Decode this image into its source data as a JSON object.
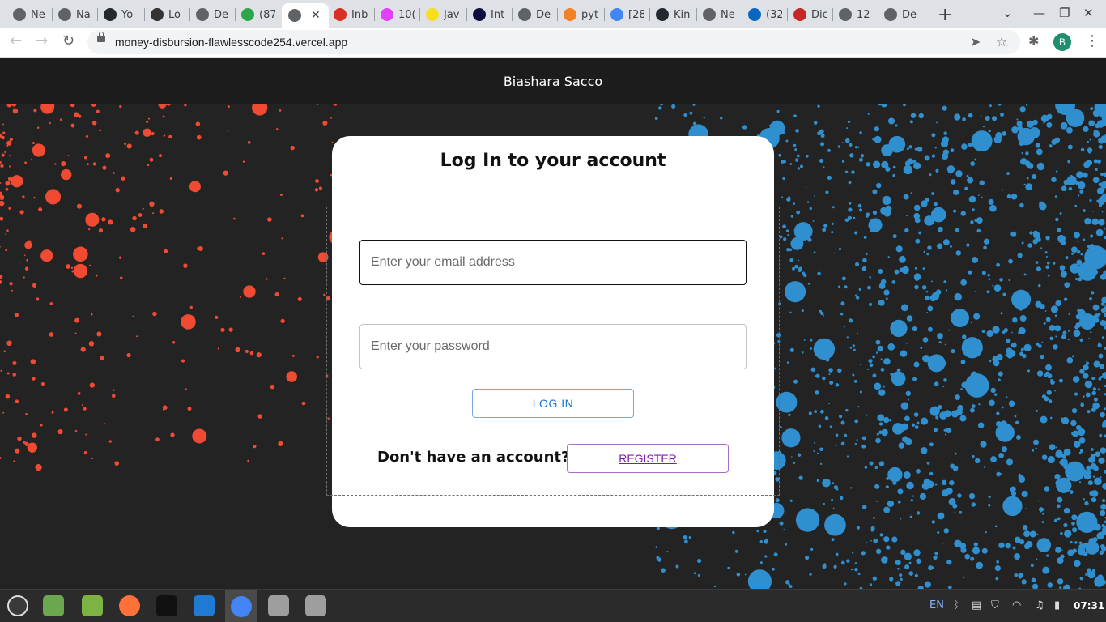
{
  "browser": {
    "tabs": [
      {
        "icon": "chrome-globe-icon",
        "title": "Ne",
        "color": "#5f6368"
      },
      {
        "icon": "globe-icon",
        "title": "Na",
        "color": "#5f6368"
      },
      {
        "icon": "github-icon",
        "title": "Yo",
        "color": "#24292f"
      },
      {
        "icon": "l-icon",
        "title": "Lo",
        "color": "#333333"
      },
      {
        "icon": "globe-icon",
        "title": "De",
        "color": "#5f6368"
      },
      {
        "icon": "badge-87-icon",
        "title": "(87",
        "color": "#2da44e"
      },
      {
        "icon": "globe-icon",
        "title": "",
        "color": "#5f6368",
        "active": true
      },
      {
        "icon": "gmail-icon",
        "title": "Inb",
        "color": "#d93025"
      },
      {
        "icon": "pinwheel-icon",
        "title": "10(",
        "color": "#e040fb"
      },
      {
        "icon": "js-icon",
        "title": "Jav",
        "color": "#f7df1e"
      },
      {
        "icon": "angular-icon",
        "title": "Int",
        "color": "#0f0f3f"
      },
      {
        "icon": "globe-icon",
        "title": "De",
        "color": "#5f6368"
      },
      {
        "icon": "stackoverflow-icon",
        "title": "pyt",
        "color": "#f48024"
      },
      {
        "icon": "google-icon",
        "title": "[28",
        "color": "#4285f4"
      },
      {
        "icon": "github-icon",
        "title": "Kin",
        "color": "#24292f"
      },
      {
        "icon": "chrome-globe-icon",
        "title": "Ne",
        "color": "#5f6368"
      },
      {
        "icon": "linkedin-icon",
        "title": "(32",
        "color": "#0a66c2"
      },
      {
        "icon": "dig-icon",
        "title": "Dic",
        "color": "#c62828"
      },
      {
        "icon": "globe-icon",
        "title": "12",
        "color": "#5f6368"
      },
      {
        "icon": "globe-icon",
        "title": "De",
        "color": "#5f6368"
      }
    ],
    "new_tab_label": "+",
    "url": "money-disbursion-flawlesscode254.vercel.app",
    "profile_initial": "B"
  },
  "app": {
    "brand": "Biashara Sacco"
  },
  "login": {
    "title": "Log In to your account",
    "email_placeholder": "Enter your email address",
    "password_placeholder": "Enter your password",
    "login_label": "LOG IN",
    "no_account_text": "Don't have an account?",
    "register_label": "REGISTER"
  },
  "taskbar": {
    "apps": [
      {
        "name": "mint-menu-icon",
        "color": "#3a3a3a"
      },
      {
        "name": "files-icon",
        "color": "#6aa84f"
      },
      {
        "name": "folder-icon",
        "color": "#7cb342"
      },
      {
        "name": "firefox-icon",
        "color": "#ff7139"
      },
      {
        "name": "terminal-icon",
        "color": "#111111"
      },
      {
        "name": "vscode-icon",
        "color": "#1f7ad4"
      },
      {
        "name": "chrome-icon",
        "color": "#4285f4"
      },
      {
        "name": "wifi-app-icon",
        "color": "#9e9e9e"
      },
      {
        "name": "wifi-app-2-icon",
        "color": "#9e9e9e"
      }
    ],
    "lang": "EN",
    "time": "07:31"
  }
}
